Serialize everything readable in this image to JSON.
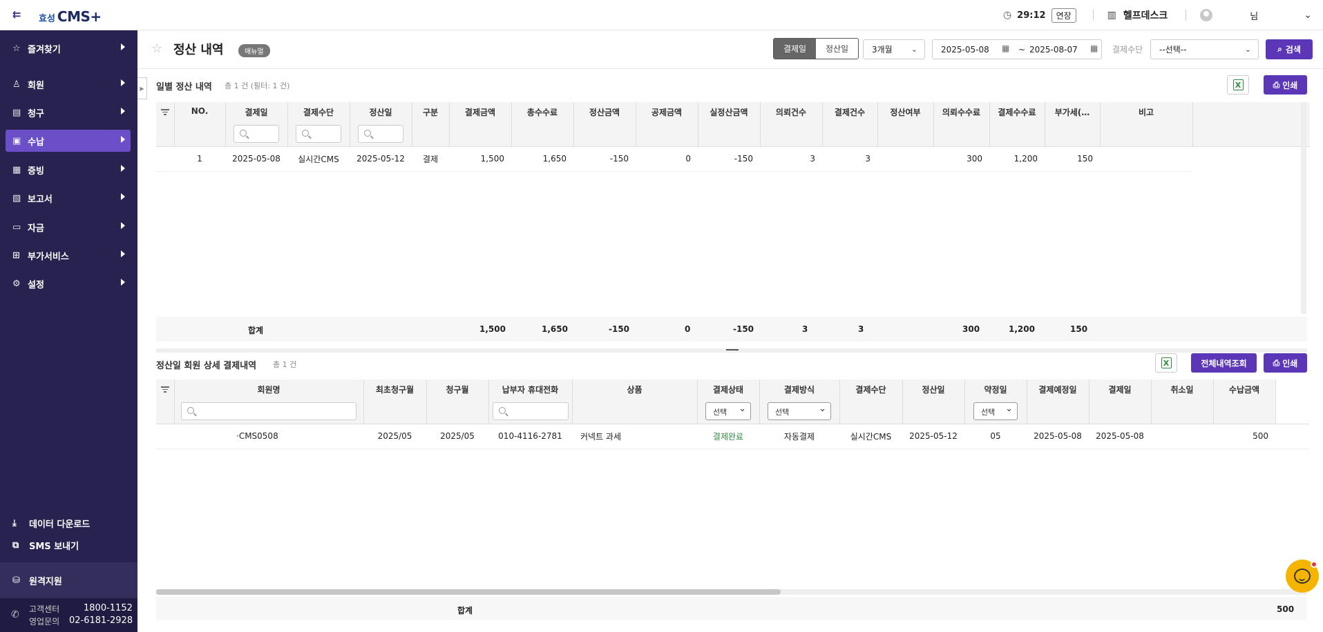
{
  "header": {
    "logo_prefix": "효성",
    "logo_main": "CMS+",
    "session_timer": "29:12",
    "extend_label": "연장",
    "helpdesk_label": "헬프데스크",
    "user_suffix": "님"
  },
  "sidebar": {
    "items": [
      {
        "label": "즐겨찾기",
        "icon": "star-icon"
      },
      {
        "label": "회원",
        "icon": "user-icon"
      },
      {
        "label": "청구",
        "icon": "invoice-icon"
      },
      {
        "label": "수납",
        "icon": "receipt-icon",
        "active": true
      },
      {
        "label": "증빙",
        "icon": "archive-icon"
      },
      {
        "label": "보고서",
        "icon": "report-icon"
      },
      {
        "label": "자금",
        "icon": "wallet-icon"
      },
      {
        "label": "부가서비스",
        "icon": "plus-box-icon"
      },
      {
        "label": "설정",
        "icon": "gear-icon"
      }
    ],
    "data_download": "데이터 다운로드",
    "sms_send": "SMS 보내기",
    "remote_support": "원격지원",
    "contacts": [
      {
        "label": "고객센터",
        "number": "1800-1152"
      },
      {
        "label": "영업문의",
        "number": "02-6181-2928"
      }
    ]
  },
  "page": {
    "title": "정산 내역",
    "manual_label": "매뉴얼"
  },
  "filters": {
    "date_type": [
      "결제일",
      "정산일"
    ],
    "date_type_selected": "결제일",
    "period": "3개월",
    "date_from": "2025-05-08",
    "date_sep": "~",
    "date_to": "2025-08-07",
    "payment_method_label": "결제수단",
    "payment_method_value": "--선택--",
    "search_label": "검색"
  },
  "daily": {
    "title": "일별 정산 내역",
    "count": "총 1 건 (필터: 1 건)",
    "print_label": "인쇄",
    "columns": [
      "NO.",
      "결제일",
      "결제수단",
      "정산일",
      "구분",
      "결제금액",
      "총수수료",
      "정산금액",
      "공제금액",
      "실정산금액",
      "의뢰건수",
      "결제건수",
      "정산여부",
      "의뢰수수료",
      "결제수수료",
      "부가세(…",
      "비고"
    ],
    "rows": [
      [
        "1",
        "2025-05-08",
        "실시간CMS",
        "2025-05-12",
        "결제",
        "1,500",
        "1,650",
        "-150",
        "0",
        "-150",
        "3",
        "3",
        "",
        "300",
        "1,200",
        "150",
        ""
      ]
    ],
    "summary": {
      "label": "합계",
      "values": [
        "1,500",
        "1,650",
        "-150",
        "0",
        "-150",
        "3",
        "3",
        "300",
        "1,200",
        "150"
      ]
    }
  },
  "detail": {
    "title": "정산일 회원 상세 결제내역",
    "count": "총 1 건",
    "all_history_label": "전체내역조회",
    "print_label": "인쇄",
    "select_placeholder": "선택",
    "columns": [
      "회원명",
      "최초청구월",
      "청구월",
      "납부자 휴대전화",
      "상품",
      "결제상태",
      "결제방식",
      "결제수단",
      "정산일",
      "약정일",
      "결제예정일",
      "결제일",
      "취소일",
      "수납금액"
    ],
    "rows": [
      [
        "·CMS0508",
        "2025/05",
        "2025/05",
        "010-4116-2781",
        "커넥트 과세",
        "결제완료",
        "자동결제",
        "실시간CMS",
        "2025-05-12",
        "05",
        "2025-05-08",
        "2025-05-08",
        "",
        "500"
      ]
    ],
    "summary": {
      "label": "합계",
      "total": "500"
    }
  },
  "colors": {
    "sidebar_bg": "#27224f",
    "accent": "#5b37b8",
    "active_menu": "#6b4fc8",
    "status_ok": "#2e8b3e"
  }
}
